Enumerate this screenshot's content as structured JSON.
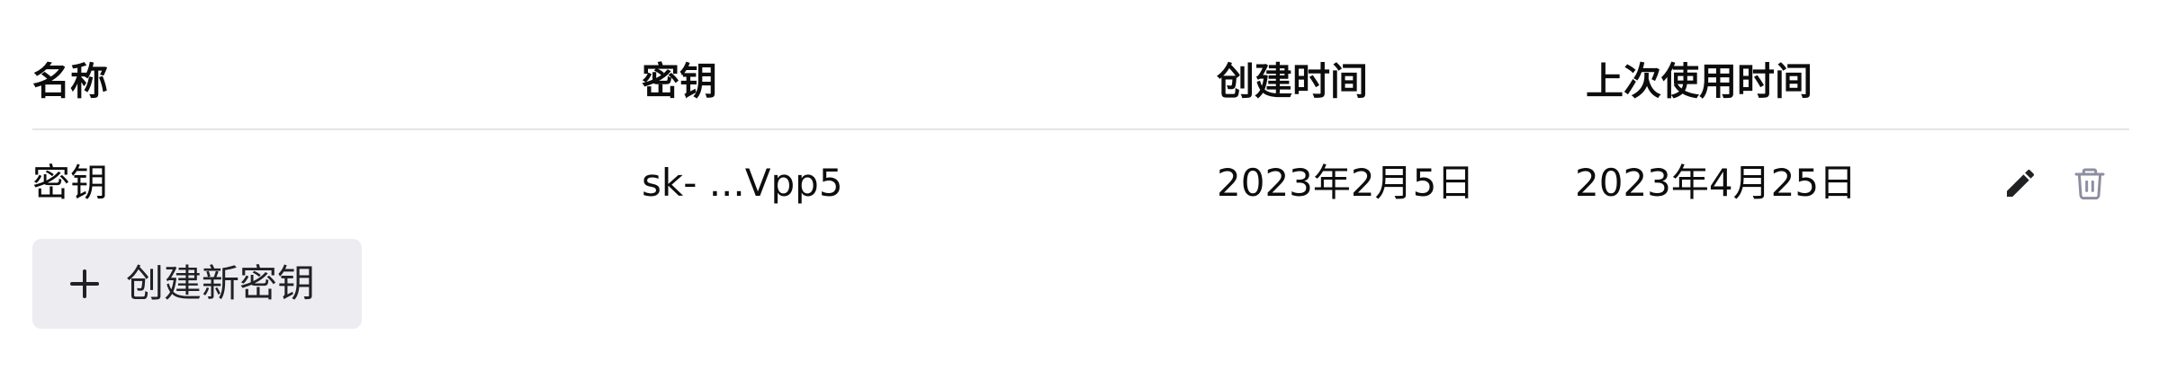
{
  "table": {
    "headers": {
      "name": "名称",
      "key": "密钥",
      "created": "创建时间",
      "last_used": "上次使用时间"
    },
    "rows": [
      {
        "name": "密钥",
        "key": "sk- ...Vpp5",
        "created": "2023年2月5日",
        "last_used": "2023年4月25日"
      }
    ]
  },
  "actions": {
    "edit_icon": "pencil-icon",
    "delete_icon": "trash-icon"
  },
  "create_button": {
    "label": "创建新密钥",
    "icon": "plus-icon"
  },
  "colors": {
    "text": "#0d0d0d",
    "divider": "#e5e5e5",
    "button_bg": "#ececf1",
    "icon_edit": "#202123",
    "icon_delete": "#8e8ea0"
  }
}
